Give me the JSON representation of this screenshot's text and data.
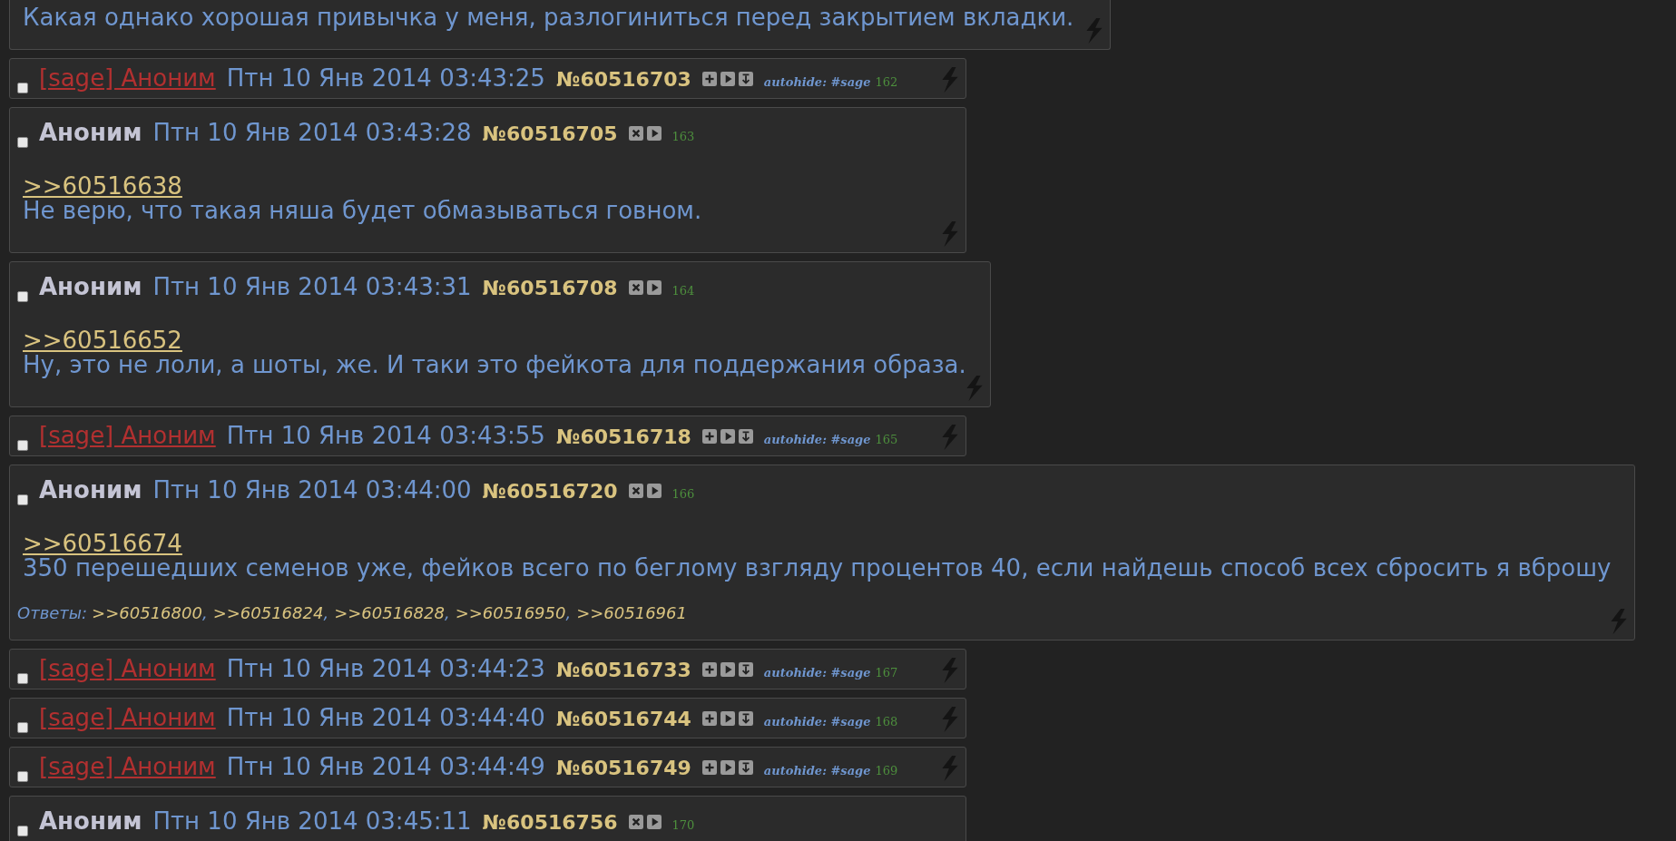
{
  "posts": [
    {
      "kind": "fragment",
      "text": "Какая однако хорошая привычка у меня, разлогиниться перед закрытием вкладки."
    },
    {
      "kind": "hidden",
      "checked": false,
      "name": "[sage] Аноним",
      "date": "Птн 10 Янв 2014 03:43:25",
      "number": "№60516703",
      "autohide": "autohide: #sage",
      "count": "162"
    },
    {
      "kind": "post",
      "checked": false,
      "name": "Аноним",
      "date": "Птн 10 Янв 2014 03:43:28",
      "number": "№60516705",
      "count": "163",
      "link": ">>60516638",
      "text": "Не верю, что такая няша будет обмазываться говном."
    },
    {
      "kind": "post",
      "checked": false,
      "name": "Аноним",
      "date": "Птн 10 Янв 2014 03:43:31",
      "number": "№60516708",
      "count": "164",
      "link": ">>60516652",
      "text": "Ну, это не лоли, а шоты, же. И таки это фейкота для поддержания образа."
    },
    {
      "kind": "hidden",
      "checked": false,
      "name": "[sage] Аноним",
      "date": "Птн 10 Янв 2014 03:43:55",
      "number": "№60516718",
      "autohide": "autohide: #sage",
      "count": "165"
    },
    {
      "kind": "post",
      "checked": false,
      "name": "Аноним",
      "date": "Птн 10 Янв 2014 03:44:00",
      "number": "№60516720",
      "count": "166",
      "link": ">>60516674",
      "text": "350 перешедших семенов уже, фейков всего по беглому взгляду процентов 40, если найдешь способ всех сбросить я вброшу",
      "replies_label": "Ответы:",
      "replies_separator": ",",
      "replies": [
        ">>60516800",
        ">>60516824",
        ">>60516828",
        ">>60516950",
        ">>60516961"
      ]
    },
    {
      "kind": "hidden",
      "checked": false,
      "name": "[sage] Аноним",
      "date": "Птн 10 Янв 2014 03:44:23",
      "number": "№60516733",
      "autohide": "autohide: #sage",
      "count": "167"
    },
    {
      "kind": "hidden",
      "checked": false,
      "name": "[sage] Аноним",
      "date": "Птн 10 Янв 2014 03:44:40",
      "number": "№60516744",
      "autohide": "autohide: #sage",
      "count": "168"
    },
    {
      "kind": "hidden",
      "checked": false,
      "name": "[sage] Аноним",
      "date": "Птн 10 Янв 2014 03:44:49",
      "number": "№60516749",
      "autohide": "autohide: #sage",
      "count": "169"
    },
    {
      "kind": "post",
      "checked": false,
      "name": "Аноним",
      "date": "Птн 10 Янв 2014 03:45:11",
      "number": "№60516756",
      "count": "170"
    }
  ]
}
